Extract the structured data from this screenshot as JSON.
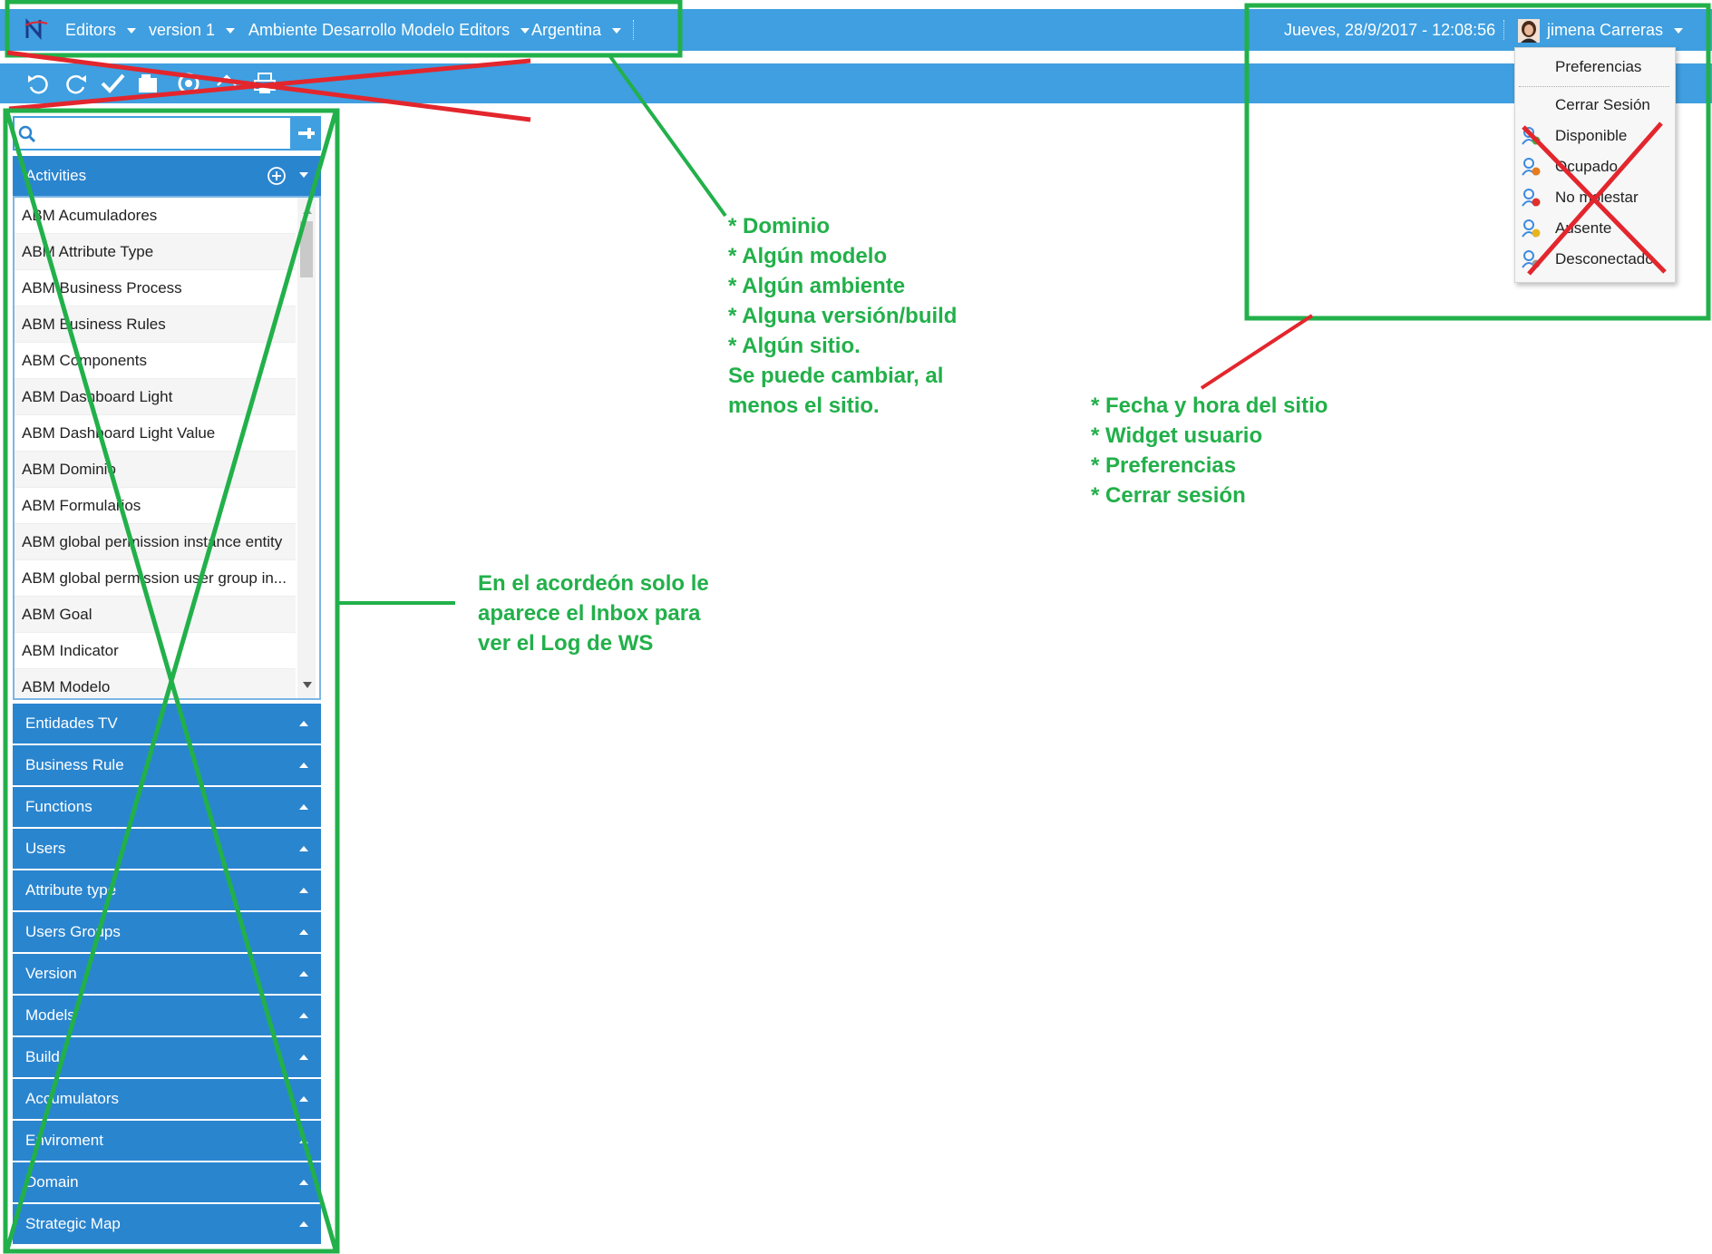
{
  "topbar": {
    "editors_label": "Editors",
    "version_label": "version 1",
    "environment_label": "Ambiente Desarrollo Modelo Editors",
    "site_label": "Argentina",
    "datetime": "Jueves, 28/9/2017 - 12:08:56",
    "user_name": "jimena Carreras",
    "logo_icon": "app-logo-icon",
    "colors": {
      "bar": "#3f9fe0",
      "text": "#ffffff"
    }
  },
  "toolbar": {
    "icons": [
      "undo-icon",
      "redo-icon",
      "check-icon",
      "folder-icon",
      "refresh-icon",
      "home-icon",
      "print-icon"
    ]
  },
  "accordion": {
    "search": {
      "value": "",
      "placeholder": ""
    },
    "activities": {
      "title": "Activities",
      "items": [
        "ABM Acumuladores",
        "ABM Attribute Type",
        "ABM Business Process",
        "ABM Business Rules",
        "ABM Components",
        "ABM Dashboard Light",
        "ABM Dashboard Light Value",
        "ABM Dominio",
        "ABM Formularios",
        "ABM global permission instance entity",
        "ABM global permission user group in...",
        "ABM Goal",
        "ABM Indicator",
        "ABM Modelo"
      ]
    },
    "sections": [
      "Entidades TV",
      "Business Rule",
      "Functions",
      "Users",
      "Attribute type",
      "Users Groups",
      "Version",
      "Models",
      "Build",
      "Accumulators",
      "Enviroment",
      "Domain",
      "Strategic Map"
    ],
    "colors": {
      "header": "#2a85cf"
    }
  },
  "user_menu": {
    "preferences": "Preferencias",
    "logout": "Cerrar Sesión",
    "statuses": [
      {
        "label": "Disponible",
        "icon": "status-available-icon",
        "color": "#3cae3c"
      },
      {
        "label": "Ocupado",
        "icon": "status-busy-icon",
        "color": "#e87b1e"
      },
      {
        "label": "No molestar",
        "icon": "status-dnd-icon",
        "color": "#e0302a"
      },
      {
        "label": "Ausente",
        "icon": "status-away-icon",
        "color": "#e8b41e"
      },
      {
        "label": "Desconectado",
        "icon": "status-offline-icon",
        "color": "#999999"
      }
    ]
  },
  "annotations": {
    "note_topbar_lines": [
      "* Dominio",
      "* Algún modelo",
      "* Algún ambiente",
      "* Alguna versión/build",
      "* Algún sitio.",
      "Se puede cambiar, al",
      "menos el sitio."
    ],
    "note_user_lines": [
      "* Fecha y hora del sitio",
      "* Widget usuario",
      "* Preferencias",
      "* Cerrar sesión"
    ],
    "note_accordion_lines": [
      "En el acordeón solo le",
      "aparece el Inbox para",
      "ver el Log de WS"
    ],
    "colors": {
      "green": "#22b04a",
      "red": "#e3262d"
    }
  }
}
